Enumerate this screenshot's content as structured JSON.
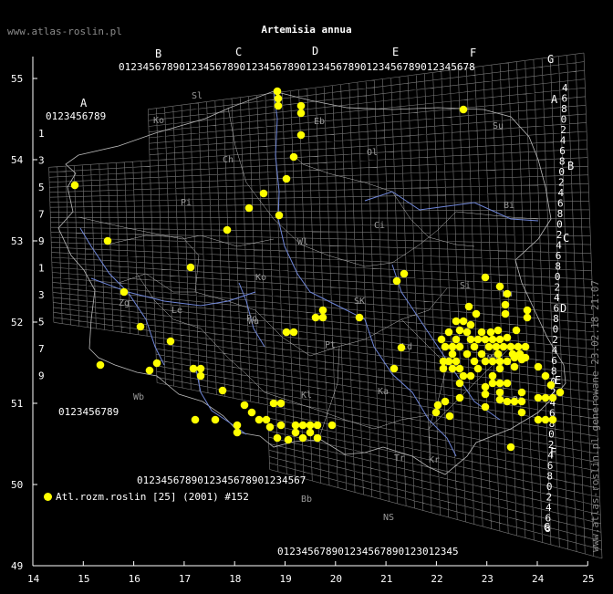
{
  "title": "Artemisia annua",
  "site_top": "www.atlas-roslin.pl",
  "site_vertical": "www.atlas-roslin.pl generowane 23.02.18 21:07",
  "legend": {
    "label": "Atl.rozm.roslin [25] (2001) #152",
    "marker_color": "#ffff00"
  },
  "colors": {
    "background": "#000000",
    "grid": "#7a7a7a",
    "frame": "#ffffff",
    "river": "#6f86d8",
    "border": "#bbbbbb",
    "marker": "#ffff00",
    "secondary_text": "#8a8a8a"
  },
  "axes": {
    "x_ticks": [
      "14",
      "15",
      "16",
      "17",
      "18",
      "19",
      "20",
      "21",
      "22",
      "23",
      "24",
      "25"
    ],
    "y_ticks": [
      "49",
      "50",
      "51",
      "52",
      "53",
      "54",
      "55"
    ]
  },
  "grid_labels": {
    "top_letters": [
      "B",
      "C",
      "D",
      "E",
      "F",
      "G"
    ],
    "left_letters": [
      "A"
    ],
    "right_letters": [
      "A",
      "B",
      "C",
      "D",
      "E",
      "F",
      "G"
    ],
    "digits": "0123456789"
  },
  "region_labels": [
    "Sl",
    "Ko",
    "Eb",
    "Ol",
    "Su",
    "Ch",
    "Pi",
    "Ci",
    "Bi",
    "Wl",
    "Ko",
    "Po",
    "SK",
    "Si",
    "Zg",
    "Le",
    "Wa",
    "Ld",
    "Ma",
    "Pt",
    "Wb",
    "Kl",
    "Kr",
    "Bb",
    "NS",
    "Tr",
    "Ka",
    "Rz",
    "Lu"
  ],
  "points_count": 152
}
